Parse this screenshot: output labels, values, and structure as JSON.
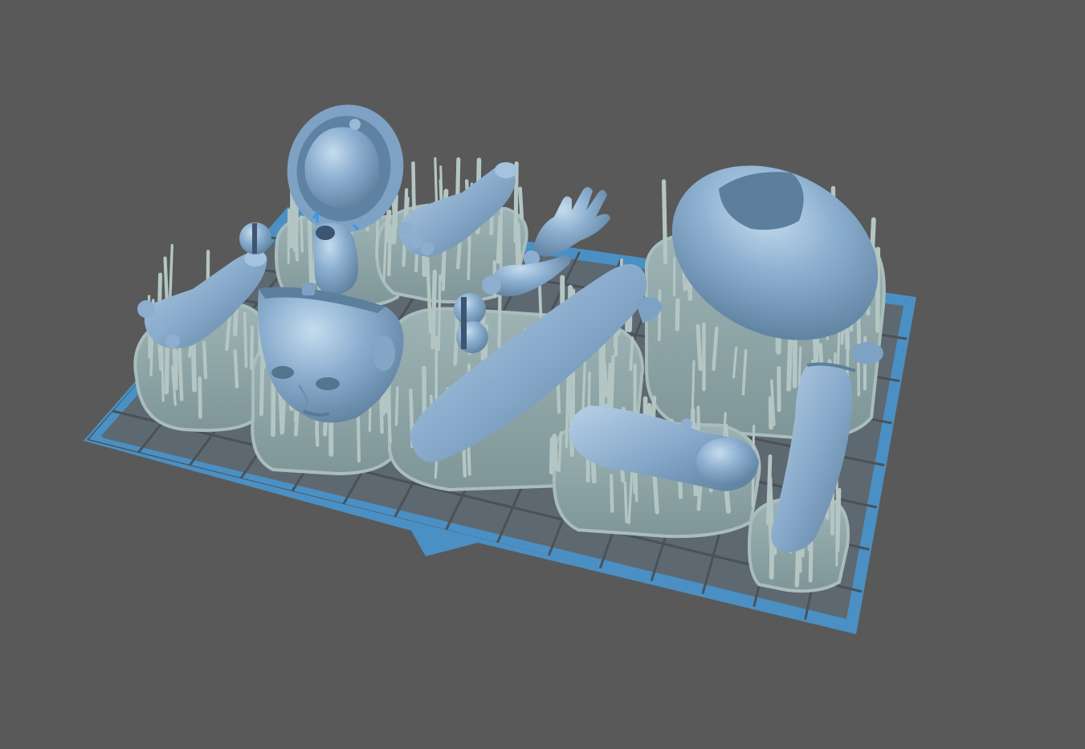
{
  "viewport": {
    "background": "#595959"
  },
  "colors": {
    "plate_border": "#4a90c4",
    "plate_floor": "#5e6870",
    "grid_line": "#4a5258",
    "raft": "#8fa6a8",
    "raft_edge": "#a9bdbd",
    "support": "#b4c6c3",
    "model": "#8cafd0",
    "model_shadow": "#5d7f9e",
    "model_highlight": "#c5dcee",
    "contact_marker": "#2f9bf0"
  },
  "scene": {
    "parts": [
      {
        "name": "head-back-shell-model"
      },
      {
        "name": "foot-right-model"
      },
      {
        "name": "foot-left-model"
      },
      {
        "name": "neck-joint-model"
      },
      {
        "name": "head-face-model"
      },
      {
        "name": "hand-open-model"
      },
      {
        "name": "hand-small-model"
      },
      {
        "name": "ball-joint-pair-model"
      },
      {
        "name": "ball-joint-small-model"
      },
      {
        "name": "thigh-model"
      },
      {
        "name": "torso-model"
      },
      {
        "name": "upper-arm-model"
      },
      {
        "name": "forearm-model"
      }
    ]
  }
}
